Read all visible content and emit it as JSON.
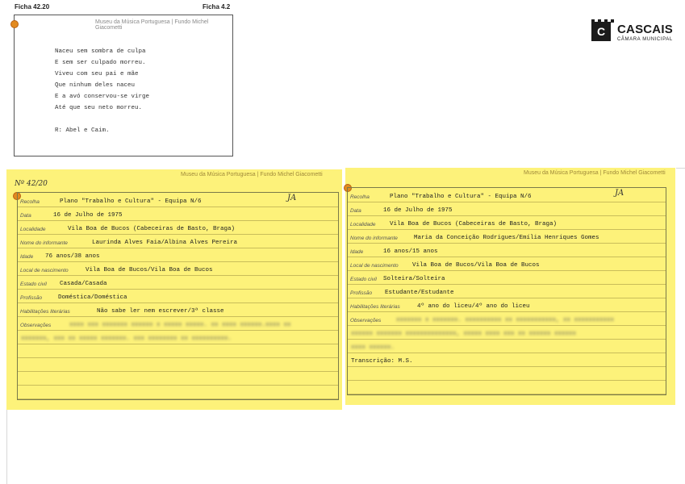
{
  "top_card": {
    "fiche_left": "Ficha 42.20",
    "fiche_right": "Ficha 4.2",
    "museum": "Museu da Música Portuguesa | Fundo Michel Giacometti",
    "poem": [
      "Naceu sem sombra de culpa",
      "E sem ser culpado morreu.",
      "Viveu com seu pai e mãe",
      "Que ninhum deles naceu",
      "E a avó conservou-se virge",
      "Até que seu neto morreu."
    ],
    "answer": "R: Abel e Caim."
  },
  "logo": {
    "letter": "C",
    "name": "CASCAIS",
    "subtitle": "CÂMARA MUNICIPAL"
  },
  "card_left": {
    "museum": "Museu da Música Portuguesa | Fundo Michel Giacometti",
    "number": "Nº 42/20",
    "initials": "JA",
    "labels": {
      "recolha": "Recolha",
      "data": "Data",
      "localidade": "Localidade",
      "informante": "Nome do informante",
      "idade": "Idade",
      "nascimento": "Local de nascimento",
      "estado": "Estado civil",
      "profissao": "Profissão",
      "habilitacoes": "Habilitações literárias",
      "observacoes": "Observações"
    },
    "values": {
      "recolha": "Plano \"Trabalho e Cultura\" - Equipa N/6",
      "data": "16 de Julho de 1975",
      "localidade": "Vila Boa de Bucos (Cabeceiras de Basto, Braga)",
      "informante": "Laurinda Alves Faia/Albina Alves Pereira",
      "idade": "76 anos/38 anos",
      "nascimento": "Vila Boa de Bucos/Vila Boa de Bucos",
      "estado": "Casada/Casada",
      "profissao": "Doméstica/Doméstica",
      "habilitacoes": "Não sabe ler nem escrever/3ª classe"
    }
  },
  "card_right": {
    "museum": "Museu da Música Portuguesa | Fundo Michel Giacometti",
    "initials": "JA",
    "labels": {
      "recolha": "Recolha",
      "data": "Data",
      "localidade": "Localidade",
      "informante": "Nome do informante",
      "idade": "Idade",
      "nascimento": "Local de nascimento",
      "estado": "Estado civil",
      "profissao": "Profissão",
      "habilitacoes": "Habilitações literárias",
      "observacoes": "Observações"
    },
    "values": {
      "recolha": "Plano \"Trabalho e Cultura\" - Equipa N/6",
      "data": "16 de Julho de 1975",
      "localidade": "Vila Boa de Bucos (Cabeceiras de Basto, Braga)",
      "informante": "Maria da Conceição Rodrigues/Emília Henriques Gomes",
      "idade": "16 anos/15 anos",
      "nascimento": "Vila Boa de Bucos/Vila Boa de Bucos",
      "estado": "Solteira/Solteira",
      "profissao": "Estudante/Estudante",
      "habilitacoes": "4º ano do liceu/4º ano do liceu"
    },
    "transcricao": "Transcrição: M.S."
  }
}
